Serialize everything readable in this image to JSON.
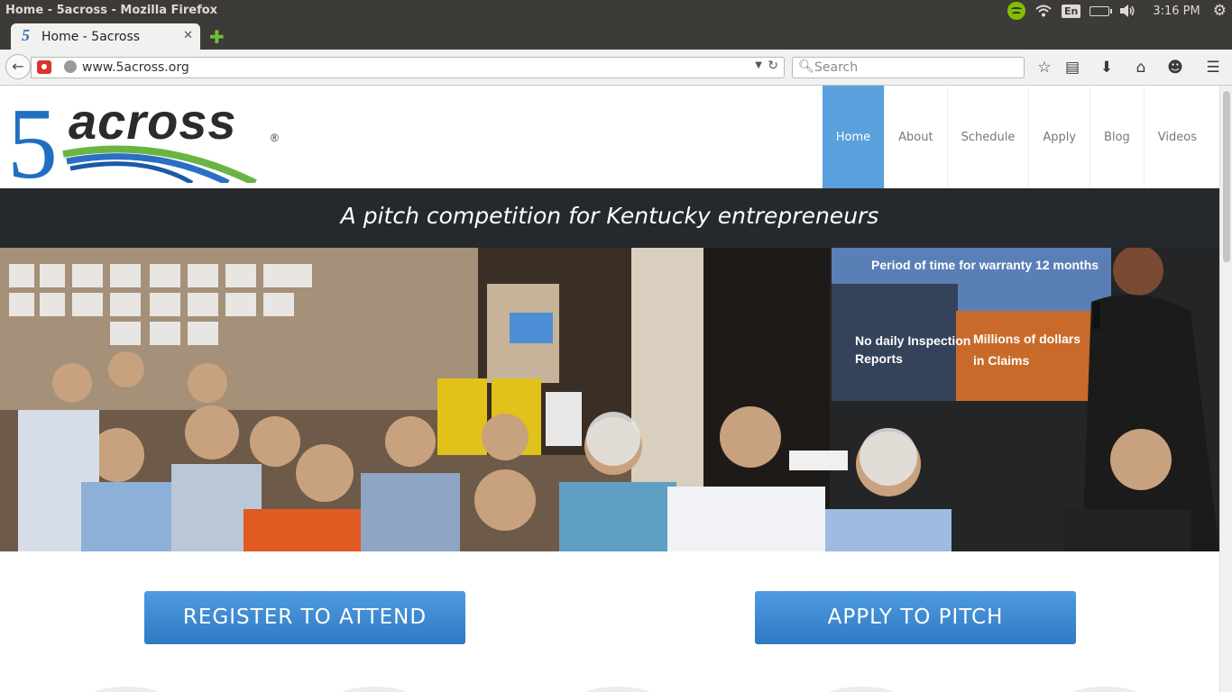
{
  "os": {
    "window_title": "Home - 5across - Mozilla Firefox",
    "keyboard_layout": "En",
    "clock": "3:16 PM"
  },
  "browser": {
    "tab_title": "Home - 5across",
    "tab_favicon": "5",
    "url": "www.5across.org",
    "search_placeholder": "Search",
    "toolbar_icons": [
      "bookmark-star-icon",
      "reading-list-icon",
      "download-icon",
      "home-icon",
      "chat-icon",
      "menu-icon"
    ]
  },
  "site": {
    "logo_digit": "5",
    "logo_word": "across",
    "logo_mark": "®",
    "nav": [
      {
        "label": "Home",
        "active": true
      },
      {
        "label": "About",
        "active": false
      },
      {
        "label": "Schedule",
        "active": false
      },
      {
        "label": "Apply",
        "active": false
      },
      {
        "label": "Blog",
        "active": false
      },
      {
        "label": "Videos",
        "active": false
      }
    ],
    "tagline": "A pitch competition for Kentucky entrepreneurs",
    "hero_slide": {
      "title": "Period of time for warranty 12 months",
      "left_text_1": "No daily Inspection",
      "left_text_2": "Reports",
      "right_text_1": "Millions of dollars",
      "right_text_2": "in Claims"
    },
    "cta": {
      "register": "REGISTER TO ATTEND",
      "apply": "APPLY TO PITCH"
    }
  },
  "colors": {
    "nav_active": "#5aa0dc",
    "tagline_bg": "#26292c",
    "button_blue": "#3a86d0",
    "logo_blue": "#1f6fc2",
    "logo_green": "#6ab443"
  }
}
